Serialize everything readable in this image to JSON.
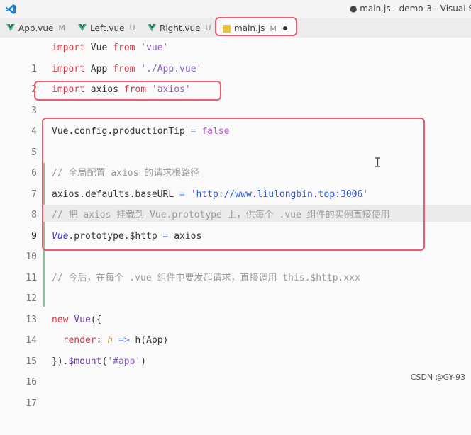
{
  "window": {
    "title": "● main.js - demo-3 - Visual S"
  },
  "tabs": [
    {
      "label": "App.vue",
      "status": "M",
      "active": false
    },
    {
      "label": "Left.vue",
      "status": "U",
      "active": false
    },
    {
      "label": "Right.vue",
      "status": "U",
      "active": false
    },
    {
      "label": "main.js",
      "status": "M",
      "active": true,
      "modified": true
    }
  ],
  "editor": {
    "line_numbers": [
      "1",
      "2",
      "3",
      "4",
      "5",
      "6",
      "7",
      "8",
      "9",
      "10",
      "11",
      "12",
      "13",
      "14",
      "15",
      "16",
      "17"
    ],
    "current_line": "9"
  },
  "code": {
    "l1": {
      "kw1": "import",
      "id": " Vue ",
      "kw2": "from",
      "sp": " ",
      "str": "'vue'"
    },
    "l2": {
      "kw1": "import",
      "id": " App ",
      "kw2": "from",
      "sp": " ",
      "str": "'./App.vue'"
    },
    "l3": {
      "kw1": "import",
      "id": " axios ",
      "kw2": "from",
      "sp": " ",
      "str": "'axios'"
    },
    "l5": {
      "lhs": "Vue.config.productionTip ",
      "op": "=",
      "sp": " ",
      "val": "false"
    },
    "l7": {
      "comment": "// 全局配置 axios 的请求根路径"
    },
    "l8": {
      "lhs": "axios.defaults.baseURL ",
      "op": "=",
      "sp": " ",
      "q1": "'",
      "url": "http://www.liulongbin.top:3006",
      "q2": "'"
    },
    "l9": {
      "comment": "// 把 axios 挂载到 Vue.prototype 上，供每个 .vue 组件的实例直接使用"
    },
    "l10": {
      "obj": "Vue",
      "rest": ".prototype.$http ",
      "op": "=",
      "tail": " axios"
    },
    "l12": {
      "comment": "// 今后，在每个 .vue 组件中要发起请求，直接调用 this.$http.xxx"
    },
    "l14": {
      "kw": "new",
      "fn": " Vue",
      "tail": "({"
    },
    "l15": {
      "indent": "  ",
      "key": "render",
      "colon": ": ",
      "param": "h",
      "sp": " ",
      "arrow": "=>",
      "call": " h(App)"
    },
    "l16": {
      "head": "}).",
      "fn": "$mount",
      "open": "(",
      "str": "'#app'",
      "close": ")"
    }
  },
  "colors": {
    "keyword": "#d73a49",
    "string": "#8e5ec4",
    "comment": "#9a9a9a",
    "annotation_box": "#ef5b6c",
    "git_added_bar": "#80c89a"
  },
  "watermark": "CSDN @GY-93"
}
